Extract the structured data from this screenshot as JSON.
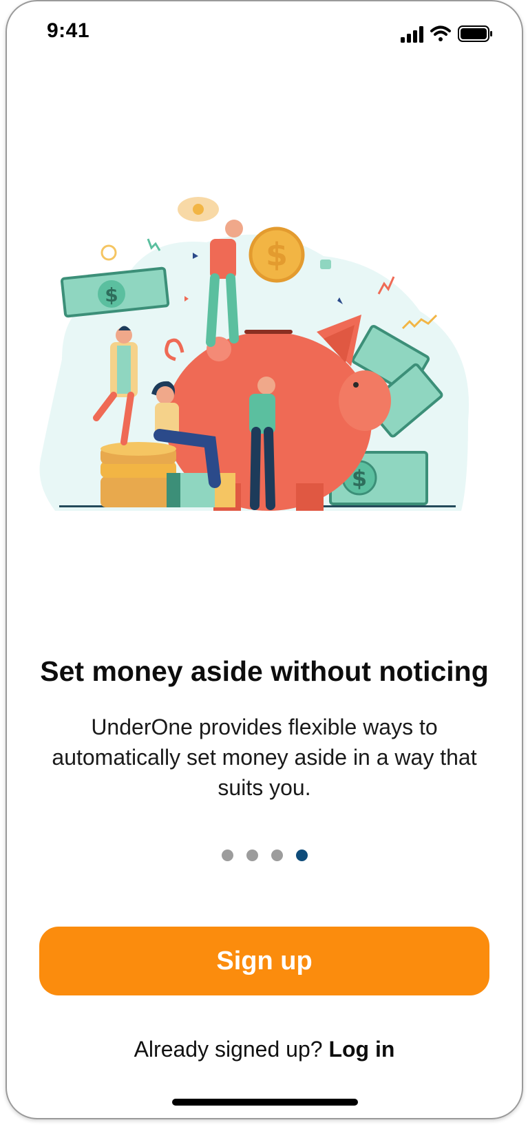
{
  "status_bar": {
    "time": "9:41",
    "icons": [
      "signal-icon",
      "wifi-icon",
      "battery-icon"
    ]
  },
  "onboarding": {
    "illustration": "piggy-bank-savings-illustration",
    "title": "Set money aside without noticing",
    "subtitle": "UnderOne provides flexible ways to automatically set money aside in a way that suits you.",
    "pagination": {
      "total": 4,
      "active": 4
    }
  },
  "actions": {
    "signup_label": "Sign up",
    "login_prompt": "Already signed up?",
    "login_label": "Log in"
  },
  "colors": {
    "accent": "#fb8c0d",
    "active_dot": "#0f4c7a",
    "inactive_dot": "#9c9c9c",
    "pig": "#ef6a55",
    "cash": "#8fd6c0",
    "coin": "#f2b544"
  }
}
